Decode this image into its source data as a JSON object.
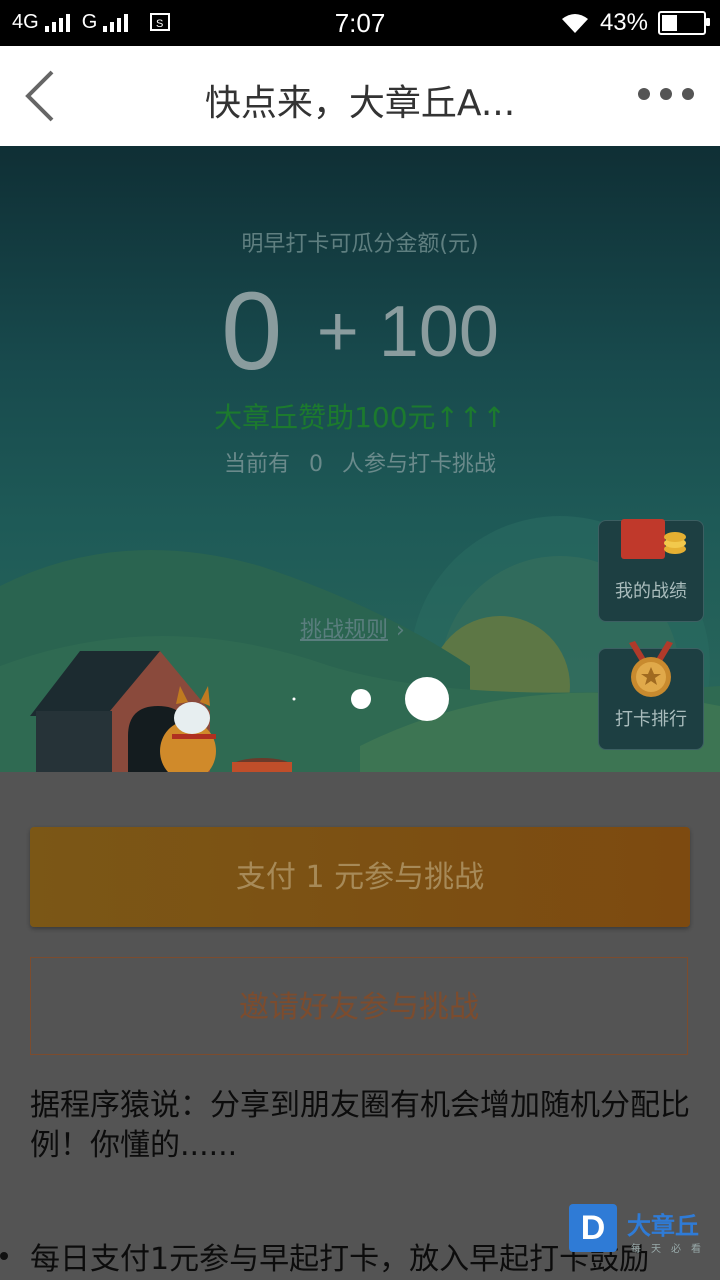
{
  "status_bar": {
    "network_left": "4G",
    "network_right": "G",
    "time": "7:07",
    "battery": "43%",
    "battery_level": 0.43
  },
  "nav": {
    "title": "快点来，大章丘A..."
  },
  "hero": {
    "subtitle": "明早打卡可瓜分金额(元)",
    "amount": "0",
    "bonus": "+ 100",
    "sponsor": "大章丘赞助100元↑↑↑",
    "participants_prefix": "当前有",
    "participants_count": "0",
    "participants_suffix": "人参与打卡挑战",
    "rules_link": "挑战规则",
    "my_record": "我的战绩",
    "rank": "打卡排行"
  },
  "actions": {
    "pay": "支付 1 元参与挑战",
    "invite": "邀请好友参与挑战"
  },
  "content": {
    "tip": "据程序猿说：分享到朋友圈有机会增加随机分配比例！你懂的......",
    "bullet": "每日支付1元参与早起打卡，放入早起打卡鼓励"
  },
  "watermark": {
    "logo_letter": "D",
    "brand": "大章丘",
    "slogan": "每天必看"
  },
  "colors": {
    "pay_button": "#7b5716",
    "invite_border": "#7c4c2e",
    "sponsor_text": "#1c7a2e"
  }
}
